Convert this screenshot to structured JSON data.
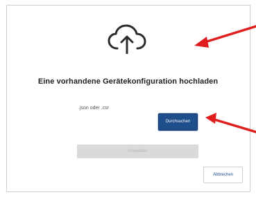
{
  "dialog": {
    "title": "Eine vorhandene Gerätekonfiguration hochladen",
    "upload_icon": "cloud-upload-icon",
    "file_hint": ".json oder .csr",
    "file_input_value": "",
    "browse_label": "Durchsuchen",
    "apply_label": "Anwenden",
    "cancel_label": "Abbrechen"
  },
  "annotations": {
    "arrow_icon": "red-arrow-icon",
    "arrow_color": "#e01e1e"
  },
  "colors": {
    "primary": "#1e4e8c",
    "disabled_bg": "#dadada",
    "disabled_text": "#b4b4b4"
  }
}
